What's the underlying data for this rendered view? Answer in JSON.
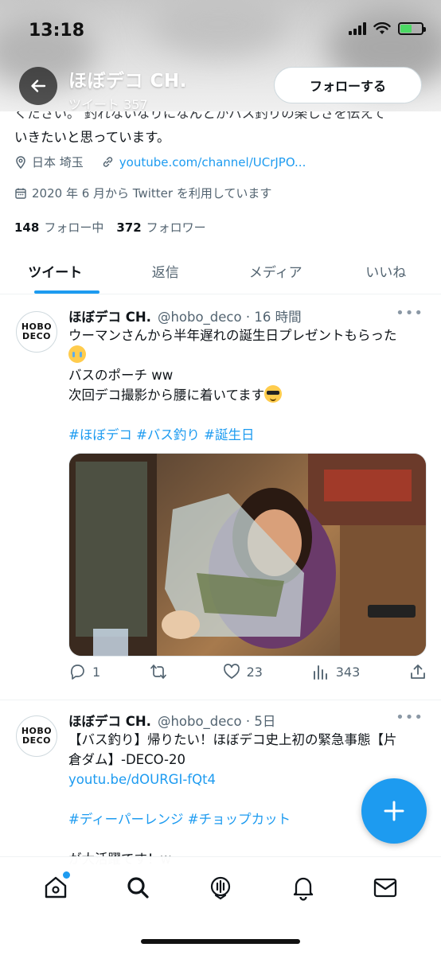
{
  "status_bar": {
    "time": "13:18"
  },
  "header": {
    "name": "ほぼデコ CH.",
    "tweet_count": "ツイート 357",
    "follow_button": "フォローする"
  },
  "profile": {
    "bio_line_1": "ください。 釣れないなりになんとかバス釣りの楽しさを伝えて",
    "bio_line_2": "いきたいと思っています。",
    "location": "日本 埼玉",
    "website": "youtube.com/channel/UCrJPO...",
    "joined": "2020 年 6 月から Twitter を利用しています",
    "following_count": "148",
    "following_label": "フォロー中",
    "followers_count": "372",
    "followers_label": "フォロワー"
  },
  "tabs": [
    {
      "label": "ツイート",
      "active": true
    },
    {
      "label": "返信",
      "active": false
    },
    {
      "label": "メディア",
      "active": false
    },
    {
      "label": "いいね",
      "active": false
    }
  ],
  "tweets": [
    {
      "name": "ほぼデコ CH.",
      "handle": "@hobo_deco · 16 時間",
      "line1": "ウーマンさんから半年遅れの誕生日プレゼントもらった",
      "line2": "バスのポーチ ww",
      "line3": "次回デコ撮影から腰に着いてます",
      "hashtags": "#ほぼデコ #バス釣り #誕生日",
      "replies": "1",
      "retweets": "",
      "likes": "23",
      "views": "343"
    },
    {
      "name": "ほぼデコ CH.",
      "handle": "@hobo_deco · 5日",
      "line1": "【バス釣り】帰りたい！ほぼデコ史上初の緊急事態【片",
      "line2": "倉ダム】-DECO-20",
      "link": "youtu.be/dOURGI-fQt4",
      "hashtags": "#ディーパーレンジ #チョップカット",
      "line4": "が大活躍です！w"
    }
  ],
  "avatar_text": {
    "top": "HOBO",
    "bottom": "DECO"
  },
  "colors": {
    "accent": "#1d9bf0",
    "text": "#0f1419",
    "muted": "#536471"
  }
}
